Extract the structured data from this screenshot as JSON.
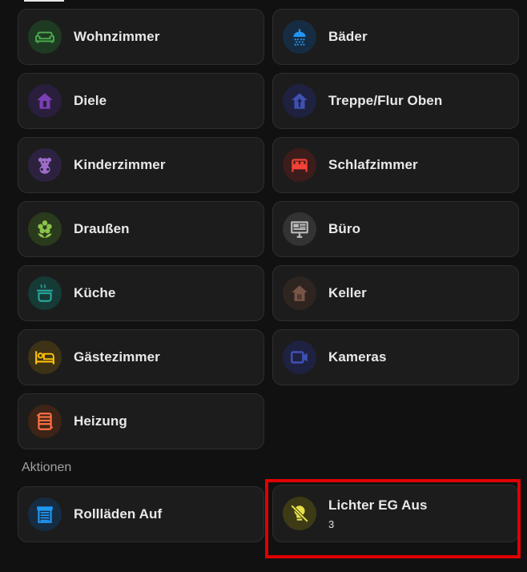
{
  "rooms": [
    {
      "name": "Wohnzimmer",
      "icon": "sofa-icon",
      "color": "#4caf50",
      "bg": "#1f3a22"
    },
    {
      "name": "Bäder",
      "icon": "shower-icon",
      "color": "#2196f3",
      "bg": "#162c42"
    },
    {
      "name": "Diele",
      "icon": "home-door-icon",
      "color": "#7b3fb5",
      "bg": "#2a1e3d"
    },
    {
      "name": "Treppe/Flur Oben",
      "icon": "home-up-icon",
      "color": "#3f51b5",
      "bg": "#1e2240"
    },
    {
      "name": "Kinderzimmer",
      "icon": "teddy-bear-icon",
      "color": "#9c6cc7",
      "bg": "#2c2240"
    },
    {
      "name": "Schlafzimmer",
      "icon": "bed-icon",
      "color": "#f44336",
      "bg": "#3d1c1c"
    },
    {
      "name": "Draußen",
      "icon": "flower-icon",
      "color": "#8bc34a",
      "bg": "#2a3a1c"
    },
    {
      "name": "Büro",
      "icon": "monitor-dashboard-icon",
      "color": "#bdbdbd",
      "bg": "#333333"
    },
    {
      "name": "Küche",
      "icon": "pot-steam-icon",
      "color": "#26a69a",
      "bg": "#163a36"
    },
    {
      "name": "Keller",
      "icon": "home-basement-icon",
      "color": "#795548",
      "bg": "#2e2420"
    },
    {
      "name": "Gästezimmer",
      "icon": "bed-guest-icon",
      "color": "#ffc107",
      "bg": "#3d3216"
    },
    {
      "name": "Kameras",
      "icon": "video-camera-icon",
      "color": "#3f51b5",
      "bg": "#1e2240"
    },
    {
      "name": "Heizung",
      "icon": "radiator-icon",
      "color": "#ff7043",
      "bg": "#3d2416"
    }
  ],
  "actions_title": "Aktionen",
  "actions": [
    {
      "name": "Rollläden Auf",
      "sub": "",
      "icon": "window-shutter-open-icon",
      "color": "#2196f3",
      "bg": "#162c42"
    },
    {
      "name": "Lichter EG Aus",
      "sub": "3",
      "icon": "lightbulb-off-icon",
      "color": "#e8e04a",
      "bg": "#3d3a16"
    }
  ]
}
